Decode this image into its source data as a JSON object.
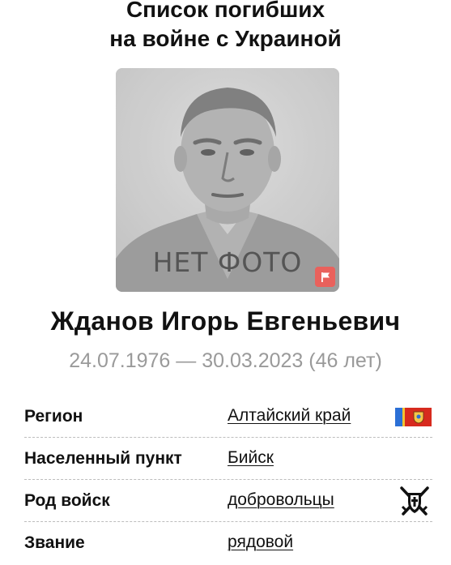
{
  "header": {
    "title_line1": "Список погибших",
    "title_line2": "на войне с Украиной"
  },
  "photo": {
    "placeholder_text": "НЕТ ФОТО",
    "flag_button_color": "#e9615c"
  },
  "person": {
    "name": "Жданов Игорь Евгеньевич",
    "dates": "24.07.1976 — 30.03.2023 (46 лет)"
  },
  "details": {
    "rows": [
      {
        "label": "Регион",
        "value": "Алтайский край",
        "icon": "region-flag-icon"
      },
      {
        "label": "Населенный пункт",
        "value": "Бийск"
      },
      {
        "label": "Род войск",
        "value": "добровольцы",
        "icon": "volunteers-emblem-icon"
      },
      {
        "label": "Звание",
        "value": "рядовой"
      }
    ]
  },
  "colors": {
    "text": "#111111",
    "muted": "#9a9a9a",
    "divider": "#bdbdbd",
    "flag_blue": "#2b6fd6",
    "flag_red": "#d72a1e"
  }
}
